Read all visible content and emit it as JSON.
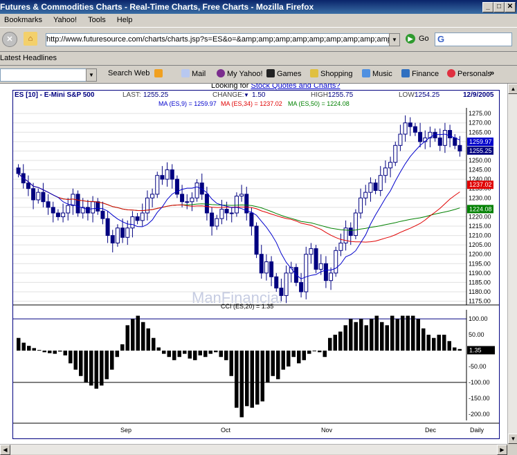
{
  "window": {
    "title": "Futures & Commodities Charts - Real-Time Charts, Free Charts - Mozilla Firefox",
    "min": "_",
    "max": "□",
    "close": "✕"
  },
  "menu": [
    "Bookmarks",
    "Yahoo!",
    "Tools",
    "Help"
  ],
  "nav": {
    "url": "http://www.futuresource.com/charts/charts.jsp?s=ES&o=&amp;amp;amp;amp;amp;amp;amp;amp;amp;a=D&z",
    "go": "Go",
    "search_logo": "G"
  },
  "bookmarks": {
    "headlines": "Latest Headlines"
  },
  "yahoo_toolbar": {
    "search_web": "Search Web",
    "mail": "Mail",
    "my_yahoo": "My Yahoo!",
    "games": "Games",
    "shopping": "Shopping",
    "music": "Music",
    "finance": "Finance",
    "personals": "Personals"
  },
  "page": {
    "looking_prefix": "Looking for ",
    "looking_link": "Stock Quotes and Charts?"
  },
  "chart_header": {
    "symbol": "ES [10] - E-Mini S&P 500",
    "last_label": "LAST:",
    "last": "1255.25",
    "change_label": "CHANGE:",
    "change": "1.50",
    "high_label": "HIGH:",
    "high": "1255.75",
    "low_label": "LOW:",
    "low": "1254.25",
    "date": "12/9/2005",
    "ma9": "MA (ES,9) = 1259.97",
    "ma34": "MA (ES,34) = 1237.02",
    "ma50": "MA (ES,50) = 1224.08"
  },
  "watermark": "ManFinancial",
  "colors": {
    "ma9": "#0000cc",
    "ma34": "#e00000",
    "ma50": "#008000",
    "cci": "#000000"
  },
  "chart_data": [
    {
      "type": "candlestick",
      "title": "ES [10] - E-Mini S&P 500",
      "ylim": [
        1173,
        1278
      ],
      "yticks": [
        1275,
        1270,
        1265,
        1260,
        1255,
        1250,
        1245,
        1240,
        1235,
        1230,
        1225,
        1220,
        1215,
        1210,
        1205,
        1200,
        1195,
        1190,
        1185,
        1180,
        1175
      ],
      "x_labels": [
        "Sep",
        "Oct",
        "Nov",
        "Dec",
        "Daily"
      ],
      "price_labels": [
        {
          "value": "1259.97",
          "series": "MA (ES,9)"
        },
        {
          "value": "1255.25",
          "series": "last"
        },
        {
          "value": "1237.02",
          "series": "MA (ES,34)"
        },
        {
          "value": "1224.08",
          "series": "MA (ES,50)"
        }
      ],
      "close": [
        1243,
        1238,
        1235,
        1229,
        1233,
        1228,
        1225,
        1222,
        1220,
        1222,
        1226,
        1232,
        1222,
        1225,
        1222,
        1228,
        1223,
        1219,
        1210,
        1206,
        1214,
        1209,
        1214,
        1220,
        1218,
        1222,
        1230,
        1232,
        1242,
        1240,
        1245,
        1240,
        1232,
        1228,
        1228,
        1230,
        1238,
        1232,
        1222,
        1215,
        1219,
        1224,
        1222,
        1222,
        1231,
        1232,
        1222,
        1215,
        1200,
        1190,
        1196,
        1188,
        1182,
        1178,
        1190,
        1193,
        1185,
        1180,
        1200,
        1203,
        1192,
        1195,
        1186,
        1190,
        1202,
        1206,
        1214,
        1210,
        1222,
        1230,
        1233,
        1238,
        1234,
        1242,
        1246,
        1249,
        1258,
        1264,
        1270,
        1268,
        1265,
        1260,
        1262,
        1265,
        1262,
        1258,
        1266,
        1262,
        1258,
        1255
      ],
      "series": [
        {
          "name": "MA (ES,9)"
        },
        {
          "name": "MA (ES,34)"
        },
        {
          "name": "MA (ES,50)"
        }
      ]
    },
    {
      "type": "bar",
      "title": "CCI (ES,20) = 1.35",
      "ylim": [
        -220,
        120
      ],
      "yticks": [
        100,
        50,
        -50,
        -100,
        -150,
        -200
      ],
      "tick_labels": [
        "100.00",
        "50.00",
        "-50.00",
        "-100.00",
        "-150.00",
        "-200.00"
      ],
      "current": "1.35",
      "values": [
        40,
        25,
        15,
        8,
        2,
        -5,
        -8,
        -10,
        -3,
        -15,
        -40,
        -60,
        -80,
        -100,
        -110,
        -120,
        -110,
        -90,
        -60,
        -20,
        20,
        80,
        100,
        110,
        90,
        70,
        40,
        10,
        -10,
        -20,
        -30,
        -20,
        -10,
        -25,
        -30,
        -15,
        -20,
        -10,
        -5,
        -20,
        -30,
        -80,
        -180,
        -210,
        -175,
        -180,
        -170,
        -160,
        -100,
        -80,
        -90,
        -60,
        -50,
        -20,
        -40,
        -30,
        -10,
        0,
        -5,
        -20,
        40,
        50,
        60,
        80,
        100,
        90,
        100,
        80,
        100,
        110,
        90,
        80,
        110,
        100,
        110,
        110,
        110,
        100,
        70,
        50,
        40,
        50,
        50,
        30,
        10,
        5
      ]
    }
  ]
}
